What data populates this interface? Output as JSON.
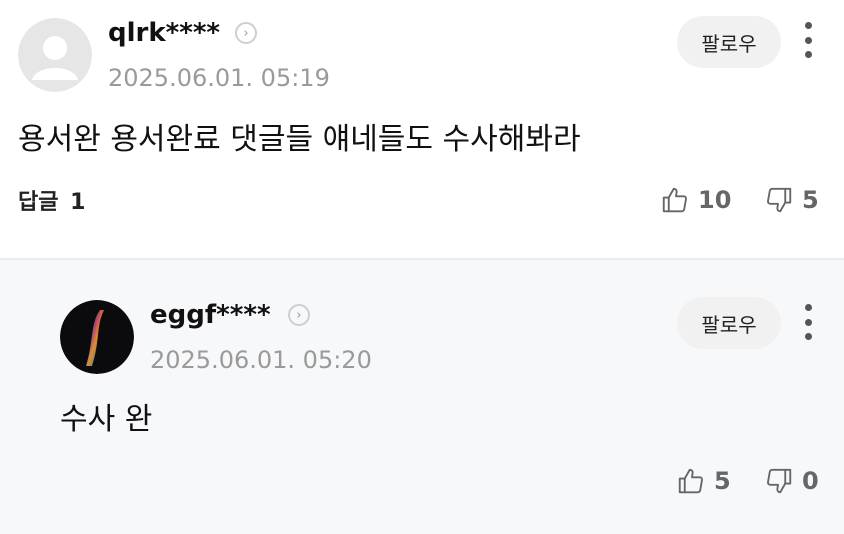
{
  "comments": [
    {
      "username": "qlrk****",
      "date": "2025.06.01. 05:19",
      "follow_label": "팔로우",
      "text": "용서완 용서완료 댓글들 얘네들도 수사해봐라",
      "reply_label": "답글",
      "reply_count": "1",
      "likes": "10",
      "dislikes": "5"
    },
    {
      "username": "eggf****",
      "date": "2025.06.01. 05:20",
      "follow_label": "팔로우",
      "text": "수사 완",
      "likes": "5",
      "dislikes": "0"
    }
  ],
  "icons": {
    "chevron": "chevron-right-icon",
    "more": "more-vertical-icon",
    "like": "thumbs-up-icon",
    "dislike": "thumbs-down-icon"
  },
  "colors": {
    "reply_background": "#f7f8fa",
    "muted_text": "#9a9a9a"
  }
}
